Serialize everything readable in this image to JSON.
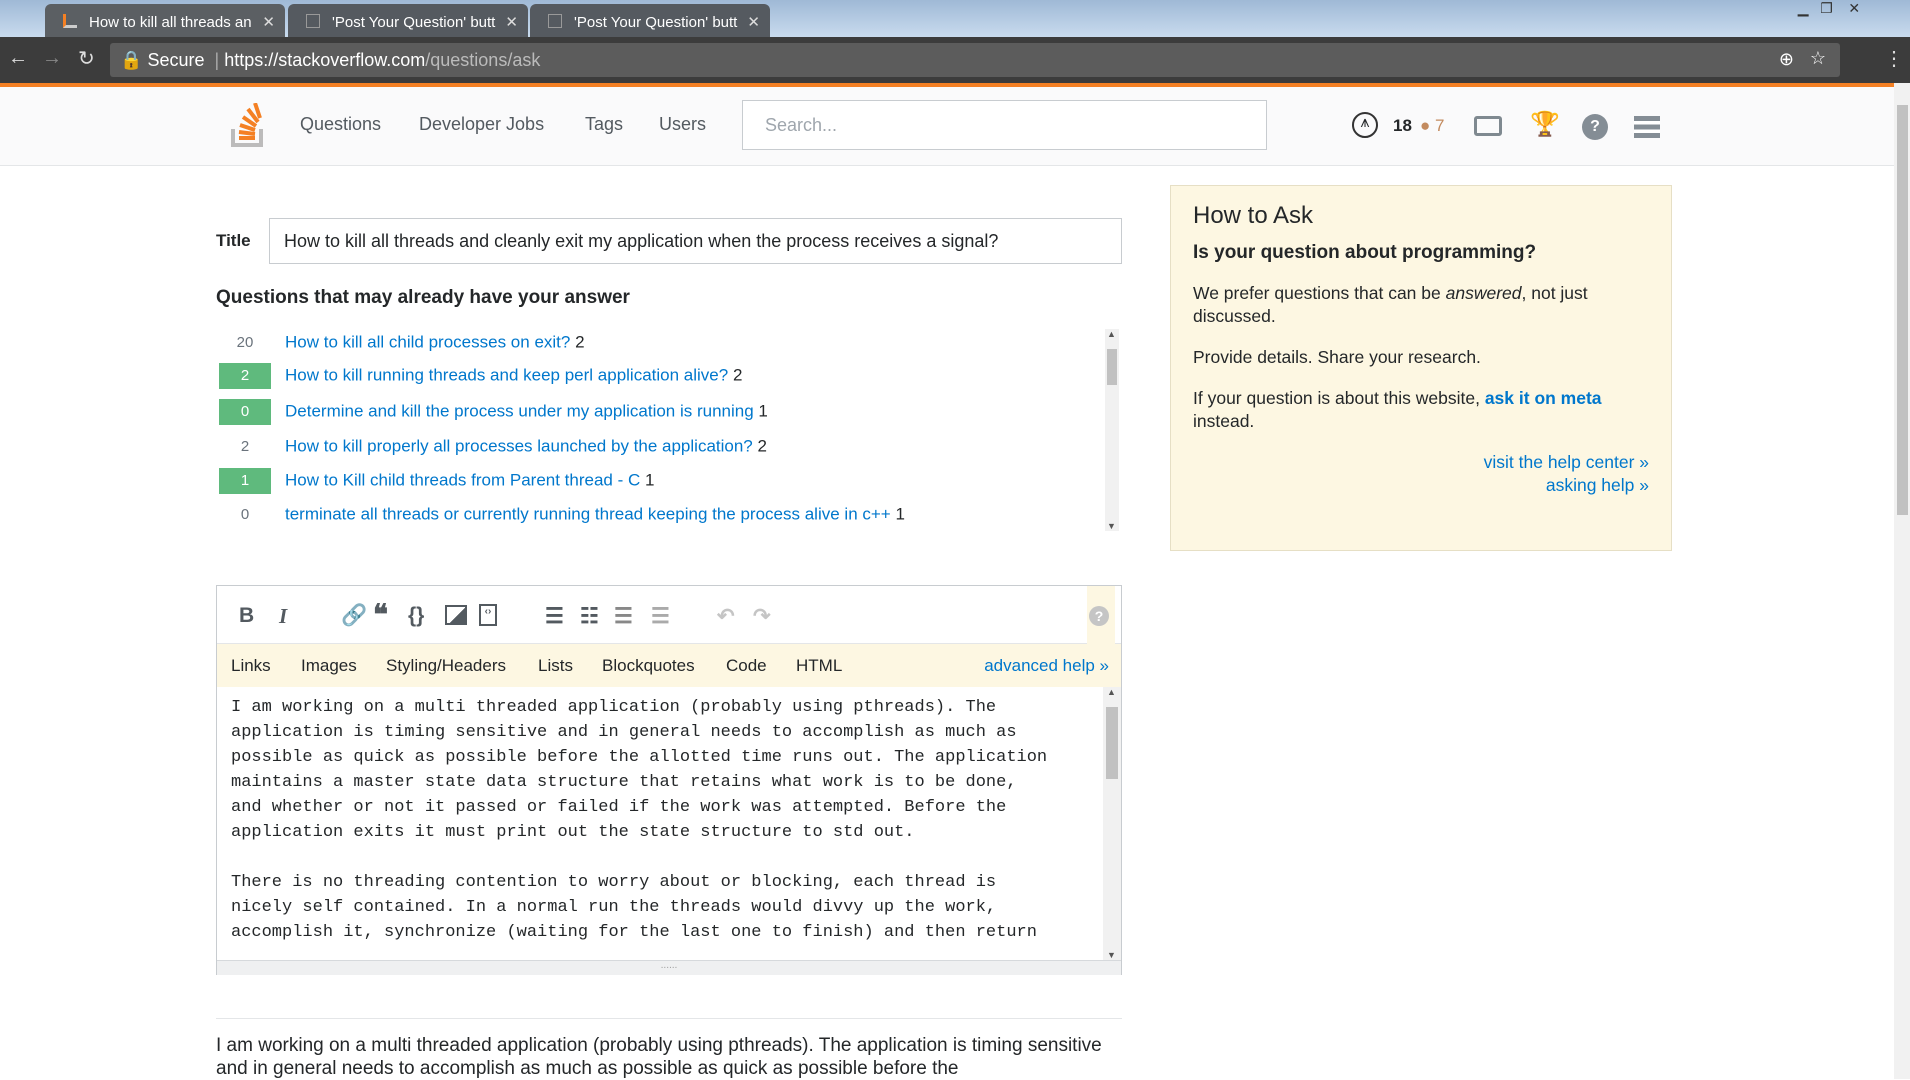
{
  "browser": {
    "tabs": [
      {
        "label": "How to kill all threads an",
        "active": true
      },
      {
        "label": "'Post Your Question' butt",
        "active": false
      },
      {
        "label": "'Post Your Question' butt",
        "active": false
      }
    ],
    "secure_label": "Secure",
    "url_host": "https://stackoverflow.com",
    "url_path": "/questions/ask"
  },
  "header": {
    "nav": [
      "Questions",
      "Developer Jobs",
      "Tags",
      "Users"
    ],
    "search_placeholder": "Search...",
    "reputation": "18",
    "bronze": "7",
    "brand_color": "#f48024"
  },
  "form": {
    "title_label": "Title",
    "title_value": "How to kill all threads and cleanly exit my application when the process receives a signal?",
    "similar_heading": "Questions that may already have your answer",
    "similar": [
      {
        "votes": "20",
        "accepted": false,
        "title": "How to kill all child processes on exit?",
        "count": "2"
      },
      {
        "votes": "2",
        "accepted": true,
        "title": "How to kill running threads and keep perl application alive?",
        "count": "2"
      },
      {
        "votes": "0",
        "accepted": true,
        "title": "Determine and kill the process under my application is running",
        "count": "1"
      },
      {
        "votes": "2",
        "accepted": false,
        "title": "How to kill properly all processes launched by the application?",
        "count": "2"
      },
      {
        "votes": "1",
        "accepted": true,
        "title": "How to Kill child threads from Parent thread - C",
        "count": "1"
      },
      {
        "votes": "0",
        "accepted": false,
        "title": "terminate all threads or currently running thread keeping the process alive in c++",
        "count": "1"
      }
    ]
  },
  "editor": {
    "help_tabs": [
      "Links",
      "Images",
      "Styling/Headers",
      "Lists",
      "Blockquotes",
      "Code",
      "HTML"
    ],
    "advanced_help": "advanced help »",
    "body": "I am working on a multi threaded application (probably using pthreads). The\napplication is timing sensitive and in general needs to accomplish as much as\npossible as quick as possible before the allotted time runs out. The application\nmaintains a master state data structure that retains what work is to be done,\nand whether or not it passed or failed if the work was attempted. Before the\napplication exits it must print out the state structure to std out.\n\nThere is no threading contention to worry about or blocking, each thread is\nnicely self contained. In a normal run the threads would divvy up the work,\naccomplish it, synchronize (waiting for the last one to finish) and then return"
  },
  "preview": "I am working on a multi threaded application (probably using pthreads). The application is timing sensitive and in general needs to accomplish as much as possible as quick as possible before the",
  "sidebar": {
    "title": "How to Ask",
    "question": "Is your question about programming?",
    "p1_a": "We prefer questions that can be ",
    "p1_em": "answered",
    "p1_b": ", not just discussed.",
    "p2": "Provide details. Share your research.",
    "p3_a": "If your question is about this website, ",
    "p3_link": "ask it on meta",
    "p3_b": " instead.",
    "link1": "visit the help center »",
    "link2": "asking help »"
  }
}
